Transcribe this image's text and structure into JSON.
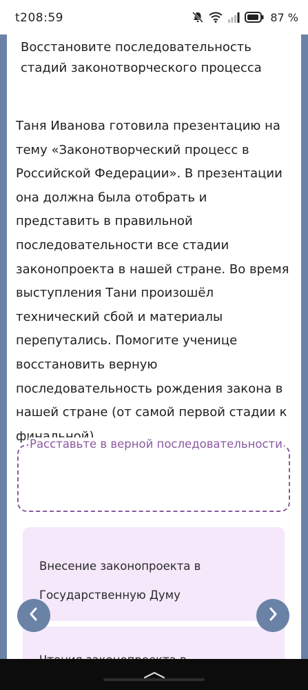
{
  "status_bar": {
    "time": "t208:59",
    "battery_percent": "87 %"
  },
  "task": {
    "title": "Восстановите последовательность стадий законотворческого процесса",
    "description": "Таня Иванова готовила презентацию на тему «Законотворческий процесс в Российской Федерации». В презентации она должна была отобрать и представить в правильной последовательности все стадии законопроекта в нашей стране. Во время выступления Тани произошёл технический сбой и материалы перепутались. Помогите ученице восстановить верную последовательность рождения закона в нашей стране (от самой первой стадии к финальной)."
  },
  "drop_zone": {
    "label": "Расставьте в верной последовательности"
  },
  "options": [
    {
      "text": "Внесение законопроекта в Государственную Думу"
    },
    {
      "text": "Чтения законопроекта в"
    }
  ],
  "colors": {
    "side_bar": "#6a82a6",
    "accent_purple": "#8b5a9c",
    "options_bg": "#f4e8fa"
  },
  "icons": {
    "prev": "chevron-left-icon",
    "next": "chevron-right-icon"
  }
}
